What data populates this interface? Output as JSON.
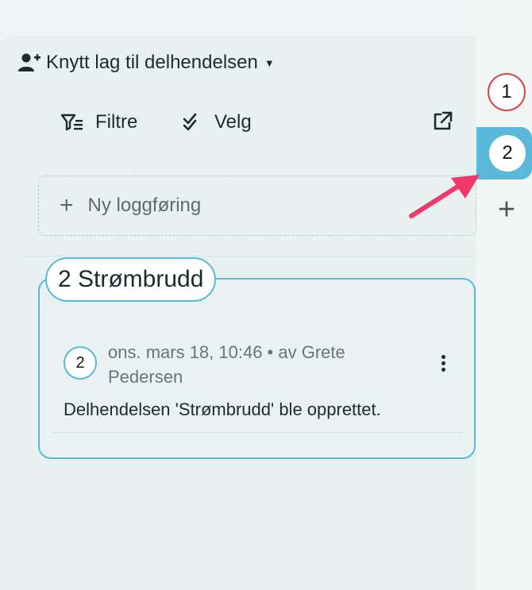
{
  "header": {
    "title": "Knytt lag til delhendelsen"
  },
  "toolbar": {
    "filter_label": "Filtre",
    "select_label": "Velg"
  },
  "new_log": {
    "label": "Ny loggføring"
  },
  "card": {
    "title": "2 Strømbrudd",
    "entry": {
      "badge": "2",
      "meta": "ons. mars 18, 10:46 • av Grete Pedersen",
      "text": "Delhendelsen 'Strømbrudd' ble opprettet."
    }
  },
  "tabs": [
    {
      "label": "1",
      "color": "#d64545"
    },
    {
      "label": "2",
      "color": "#5ab8d8"
    }
  ],
  "colors": {
    "accent": "#5ab8d8",
    "annotation_arrow": "#f0386b"
  },
  "icons": [
    "add-user-icon",
    "filter-icon",
    "checkmark-icon",
    "external-link-icon",
    "plus-icon",
    "more-vertical-icon"
  ]
}
